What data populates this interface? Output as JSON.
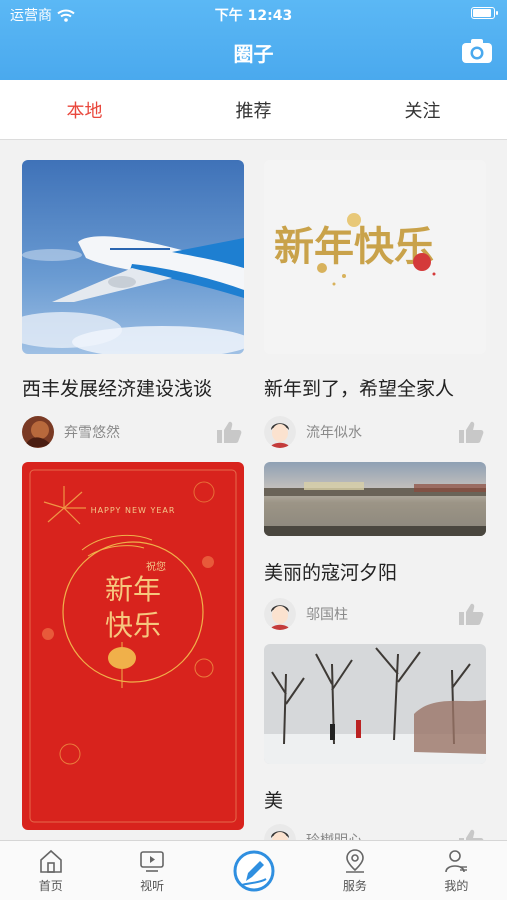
{
  "status_bar": {
    "carrier": "运营商",
    "time": "下午 12:43"
  },
  "header": {
    "title": "圈子",
    "camera_icon": "camera-icon"
  },
  "tabs": [
    {
      "label": "本地",
      "active": true
    },
    {
      "label": "推荐",
      "active": false
    },
    {
      "label": "关注",
      "active": false
    }
  ],
  "posts": [
    {
      "title": "西丰发展经济建设浅谈",
      "author": "弃雪悠然",
      "image": "airplane-sky-image"
    },
    {
      "title": "新年到了，希望全家人",
      "author": "流年似水",
      "image": "new-year-calligraphy-image"
    },
    {
      "title": "",
      "author": "",
      "image": "red-new-year-card-image",
      "card_text": {
        "english": "HAPPY NEW YEAR",
        "small": "祝您",
        "big_line1": "新年",
        "big_line2": "快乐"
      }
    },
    {
      "title": "美丽的寇河夕阳",
      "author": "邬国柱",
      "image": "river-sunset-image"
    },
    {
      "title": "美",
      "author": "玲樾明心",
      "image": "snowy-park-image"
    }
  ],
  "bottom_nav": [
    {
      "label": "首页",
      "icon": "home-icon"
    },
    {
      "label": "视听",
      "icon": "tv-icon"
    },
    {
      "label": "",
      "icon": "compose-icon"
    },
    {
      "label": "服务",
      "icon": "location-pin-icon"
    },
    {
      "label": "我的",
      "icon": "profile-icon"
    }
  ],
  "colors": {
    "header": "#4aa9ee",
    "active_tab": "#e9473c",
    "card_red": "#d8231d"
  }
}
